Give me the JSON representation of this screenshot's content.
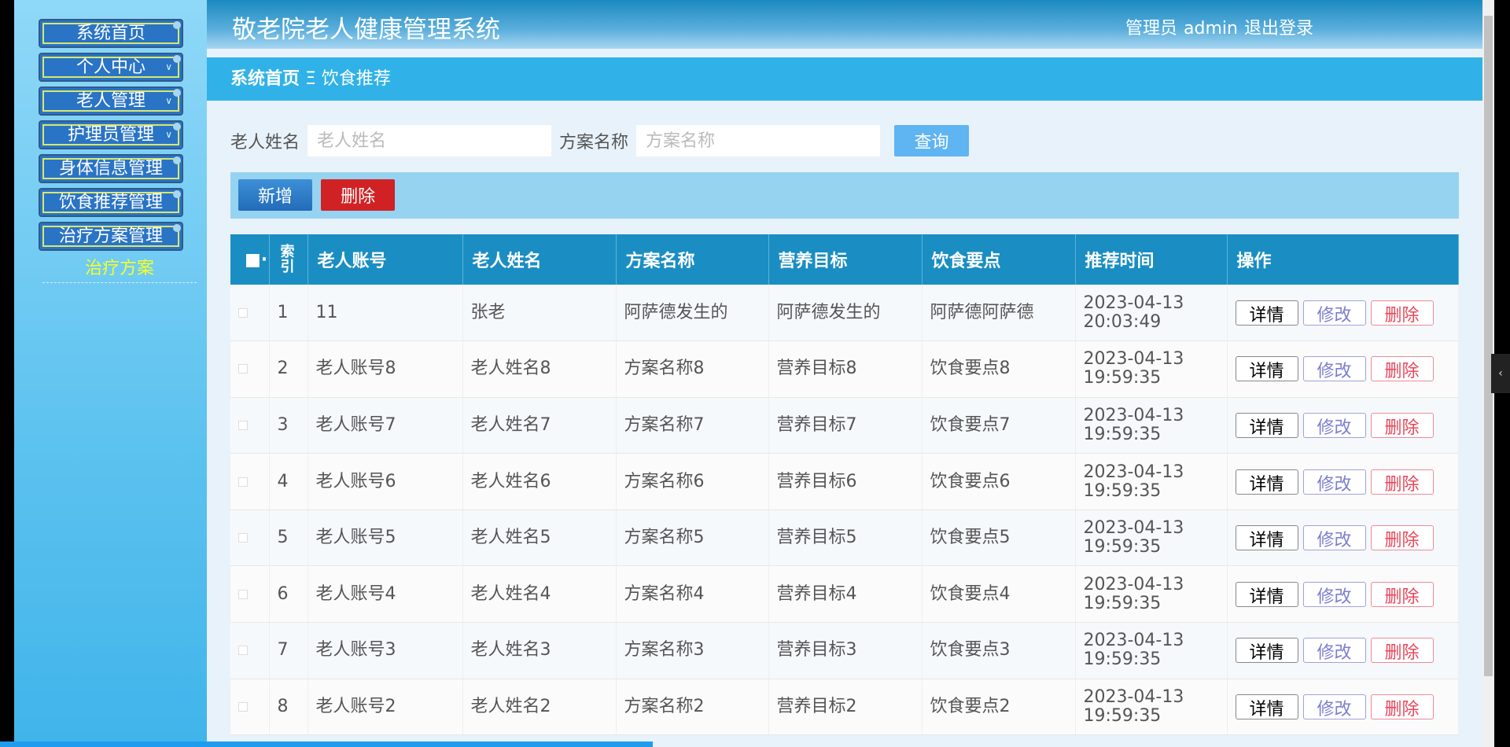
{
  "sidebar": {
    "items": [
      "系统首页",
      "个人中心",
      "老人管理",
      "护理员管理",
      "身体信息管理",
      "饮食推荐管理",
      "治疗方案管理"
    ],
    "sub_item": "治疗方案"
  },
  "header": {
    "title": "敬老院老人健康管理系统",
    "role": "管理员",
    "user": "admin",
    "logout": "退出登录"
  },
  "breadcrumb": {
    "home": "系统首页",
    "sep": "Ξ",
    "current": "饮食推荐"
  },
  "search": {
    "label1": "老人姓名",
    "placeholder1": "老人姓名",
    "label2": "方案名称",
    "placeholder2": "方案名称",
    "button": "查询"
  },
  "toolbar": {
    "add": "新增",
    "delete": "删除"
  },
  "table": {
    "headers": [
      "索引",
      "老人账号",
      "老人姓名",
      "方案名称",
      "营养目标",
      "饮食要点",
      "推荐时间",
      "操作"
    ],
    "actions": {
      "detail": "详情",
      "edit": "修改",
      "delete": "删除"
    },
    "rows": [
      [
        "1",
        "11",
        "张老",
        "阿萨德发生的",
        "阿萨德发生的",
        "阿萨德阿萨德",
        "2023-04-13 20:03:49"
      ],
      [
        "2",
        "老人账号8",
        "老人姓名8",
        "方案名称8",
        "营养目标8",
        "饮食要点8",
        "2023-04-13 19:59:35"
      ],
      [
        "3",
        "老人账号7",
        "老人姓名7",
        "方案名称7",
        "营养目标7",
        "饮食要点7",
        "2023-04-13 19:59:35"
      ],
      [
        "4",
        "老人账号6",
        "老人姓名6",
        "方案名称6",
        "营养目标6",
        "饮食要点6",
        "2023-04-13 19:59:35"
      ],
      [
        "5",
        "老人账号5",
        "老人姓名5",
        "方案名称5",
        "营养目标5",
        "饮食要点5",
        "2023-04-13 19:59:35"
      ],
      [
        "6",
        "老人账号4",
        "老人姓名4",
        "方案名称4",
        "营养目标4",
        "饮食要点4",
        "2023-04-13 19:59:35"
      ],
      [
        "7",
        "老人账号3",
        "老人姓名3",
        "方案名称3",
        "营养目标3",
        "饮食要点3",
        "2023-04-13 19:59:35"
      ],
      [
        "8",
        "老人账号2",
        "老人姓名2",
        "方案名称2",
        "营养目标2",
        "饮食要点2",
        "2023-04-13 19:59:35"
      ]
    ]
  }
}
